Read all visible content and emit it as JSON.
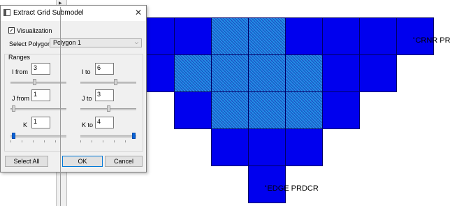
{
  "dialog": {
    "title": "Extract Grid Submodel",
    "close_glyph": "✕",
    "visualization_label": "Visualization",
    "visualization_checked": true,
    "select_polygon_label": "Select Polygon",
    "polygon_value": "Polygon 1",
    "ranges_label": "Ranges",
    "i_from_label": "I  from",
    "i_from_value": "3",
    "i_to_label": "I  to",
    "i_to_value": "6",
    "j_from_label": "J  from",
    "j_from_value": "1",
    "j_to_label": "J  to",
    "j_to_value": "3",
    "k_label": "K",
    "k_from_value": "1",
    "k_to_label": "K to",
    "k_to_value": "4",
    "select_all": "Select All",
    "ok": "OK",
    "cancel": "Cancel"
  },
  "grid": {
    "cell_color": "#0000ee",
    "selected_color": "#2f7de0",
    "labels": {
      "crnr": "CRNR PR",
      "edge": "EDGE PRDCR"
    }
  },
  "icons": {
    "app": "window-icon",
    "close": "close-icon",
    "dropdown": "chevron-down-icon"
  }
}
